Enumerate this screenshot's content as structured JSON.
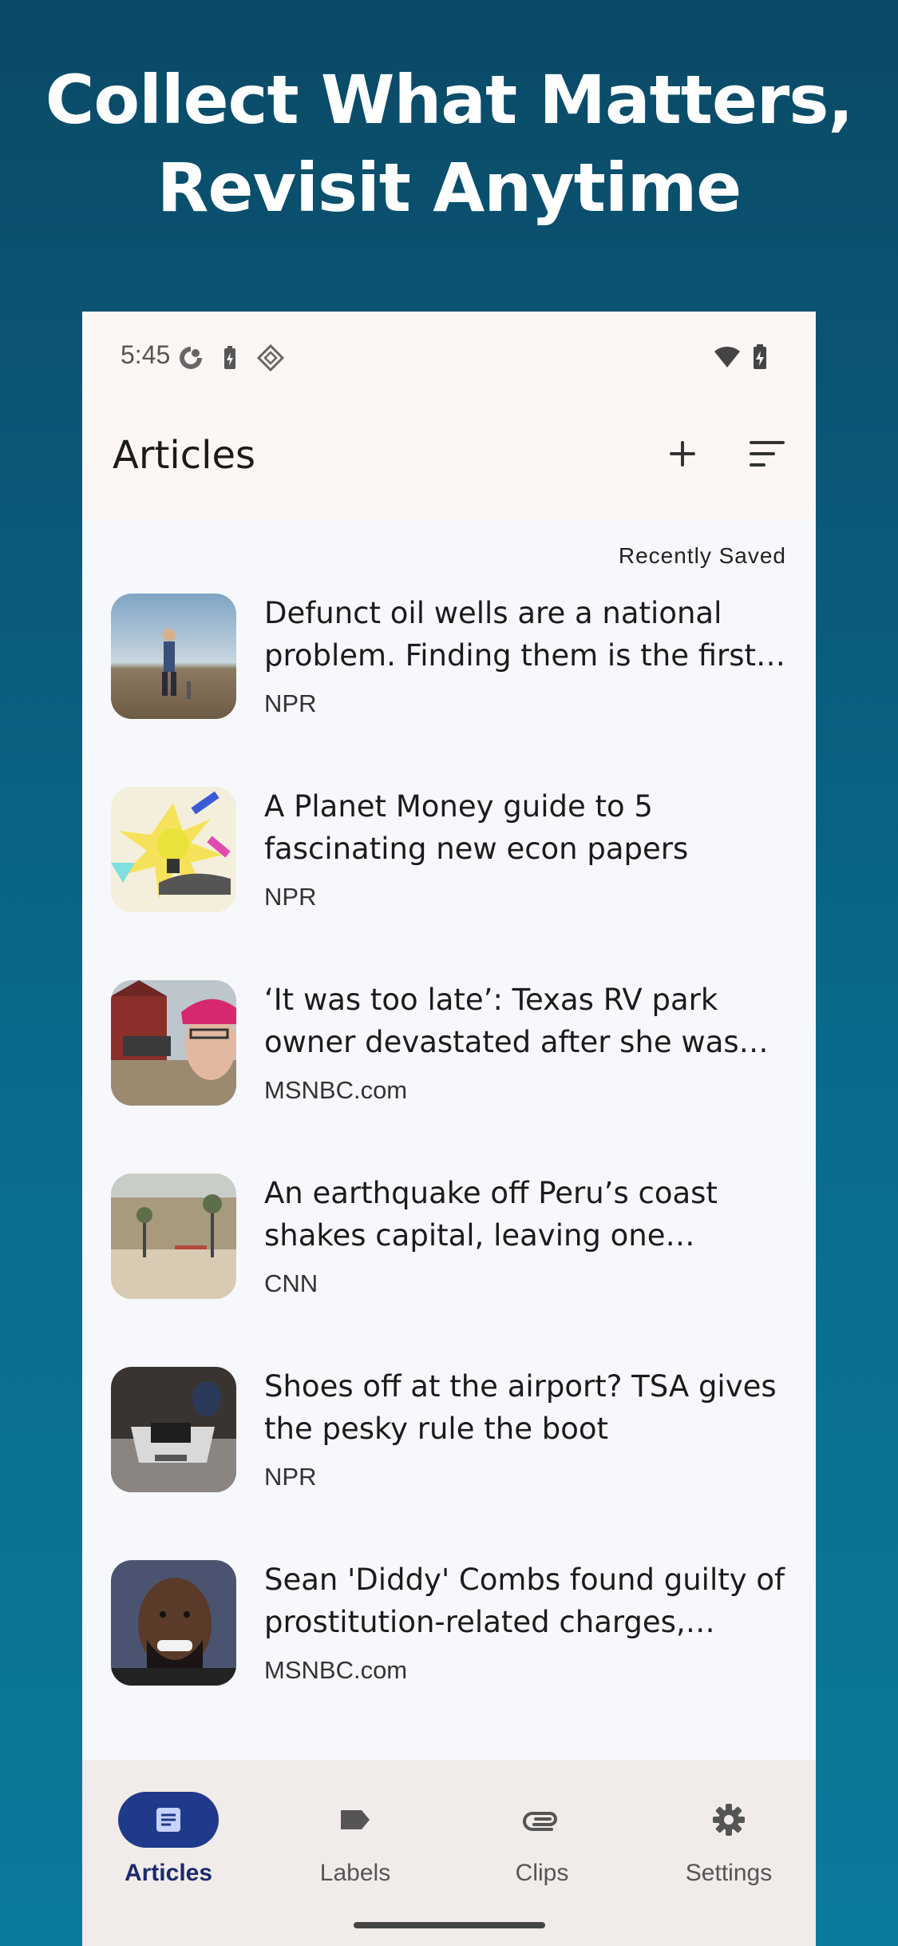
{
  "promo": {
    "line1": "Collect What Matters,",
    "line2": "Revisit Anytime"
  },
  "status_bar": {
    "time": "5:45"
  },
  "app_bar": {
    "title": "Articles"
  },
  "list": {
    "sort_label": "Recently Saved",
    "articles": [
      {
        "title": "Defunct oil wells are a national problem. Finding them is the first s…",
        "source": "NPR"
      },
      {
        "title": "A Planet Money guide to 5 fascinating new econ papers",
        "source": "NPR"
      },
      {
        "title": "‘It was too late’: Texas RV park owner devastated after she was u…",
        "source": "MSNBC.com"
      },
      {
        "title": "An earthquake off Peru’s coast shakes capital, leaving one person…",
        "source": "CNN"
      },
      {
        "title": "Shoes off at the airport? TSA gives the pesky rule the boot",
        "source": "NPR"
      },
      {
        "title": "Sean 'Diddy' Combs found guilty of prostitution-related charges, judg…",
        "source": "MSNBC.com"
      }
    ]
  },
  "bottom_nav": {
    "items": [
      {
        "label": "Articles",
        "icon": "article-icon",
        "active": true
      },
      {
        "label": "Labels",
        "icon": "label-icon",
        "active": false
      },
      {
        "label": "Clips",
        "icon": "paperclip-icon",
        "active": false
      },
      {
        "label": "Settings",
        "icon": "gear-icon",
        "active": false
      }
    ]
  },
  "colors": {
    "accent": "#1f3a8a",
    "background": "#0a5b7b"
  }
}
